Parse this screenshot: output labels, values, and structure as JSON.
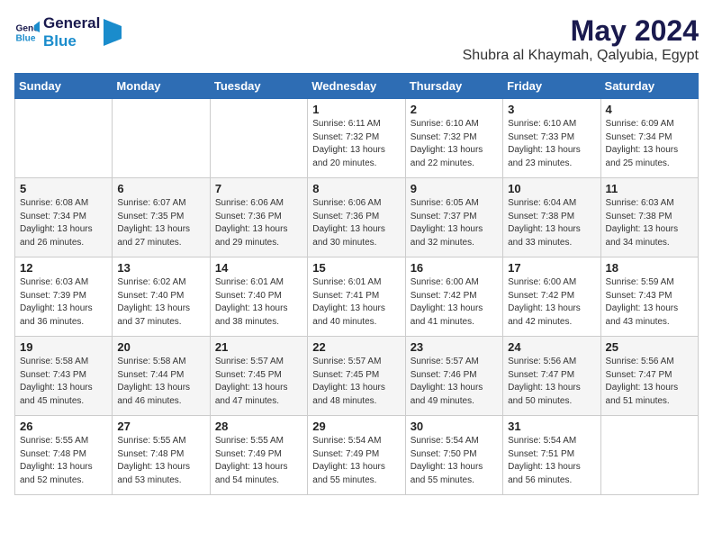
{
  "header": {
    "logo_line1": "General",
    "logo_line2": "Blue",
    "month": "May 2024",
    "location": "Shubra al Khaymah, Qalyubia, Egypt"
  },
  "weekdays": [
    "Sunday",
    "Monday",
    "Tuesday",
    "Wednesday",
    "Thursday",
    "Friday",
    "Saturday"
  ],
  "weeks": [
    [
      {
        "day": "",
        "info": ""
      },
      {
        "day": "",
        "info": ""
      },
      {
        "day": "",
        "info": ""
      },
      {
        "day": "1",
        "info": "Sunrise: 6:11 AM\nSunset: 7:32 PM\nDaylight: 13 hours\nand 20 minutes."
      },
      {
        "day": "2",
        "info": "Sunrise: 6:10 AM\nSunset: 7:32 PM\nDaylight: 13 hours\nand 22 minutes."
      },
      {
        "day": "3",
        "info": "Sunrise: 6:10 AM\nSunset: 7:33 PM\nDaylight: 13 hours\nand 23 minutes."
      },
      {
        "day": "4",
        "info": "Sunrise: 6:09 AM\nSunset: 7:34 PM\nDaylight: 13 hours\nand 25 minutes."
      }
    ],
    [
      {
        "day": "5",
        "info": "Sunrise: 6:08 AM\nSunset: 7:34 PM\nDaylight: 13 hours\nand 26 minutes."
      },
      {
        "day": "6",
        "info": "Sunrise: 6:07 AM\nSunset: 7:35 PM\nDaylight: 13 hours\nand 27 minutes."
      },
      {
        "day": "7",
        "info": "Sunrise: 6:06 AM\nSunset: 7:36 PM\nDaylight: 13 hours\nand 29 minutes."
      },
      {
        "day": "8",
        "info": "Sunrise: 6:06 AM\nSunset: 7:36 PM\nDaylight: 13 hours\nand 30 minutes."
      },
      {
        "day": "9",
        "info": "Sunrise: 6:05 AM\nSunset: 7:37 PM\nDaylight: 13 hours\nand 32 minutes."
      },
      {
        "day": "10",
        "info": "Sunrise: 6:04 AM\nSunset: 7:38 PM\nDaylight: 13 hours\nand 33 minutes."
      },
      {
        "day": "11",
        "info": "Sunrise: 6:03 AM\nSunset: 7:38 PM\nDaylight: 13 hours\nand 34 minutes."
      }
    ],
    [
      {
        "day": "12",
        "info": "Sunrise: 6:03 AM\nSunset: 7:39 PM\nDaylight: 13 hours\nand 36 minutes."
      },
      {
        "day": "13",
        "info": "Sunrise: 6:02 AM\nSunset: 7:40 PM\nDaylight: 13 hours\nand 37 minutes."
      },
      {
        "day": "14",
        "info": "Sunrise: 6:01 AM\nSunset: 7:40 PM\nDaylight: 13 hours\nand 38 minutes."
      },
      {
        "day": "15",
        "info": "Sunrise: 6:01 AM\nSunset: 7:41 PM\nDaylight: 13 hours\nand 40 minutes."
      },
      {
        "day": "16",
        "info": "Sunrise: 6:00 AM\nSunset: 7:42 PM\nDaylight: 13 hours\nand 41 minutes."
      },
      {
        "day": "17",
        "info": "Sunrise: 6:00 AM\nSunset: 7:42 PM\nDaylight: 13 hours\nand 42 minutes."
      },
      {
        "day": "18",
        "info": "Sunrise: 5:59 AM\nSunset: 7:43 PM\nDaylight: 13 hours\nand 43 minutes."
      }
    ],
    [
      {
        "day": "19",
        "info": "Sunrise: 5:58 AM\nSunset: 7:43 PM\nDaylight: 13 hours\nand 45 minutes."
      },
      {
        "day": "20",
        "info": "Sunrise: 5:58 AM\nSunset: 7:44 PM\nDaylight: 13 hours\nand 46 minutes."
      },
      {
        "day": "21",
        "info": "Sunrise: 5:57 AM\nSunset: 7:45 PM\nDaylight: 13 hours\nand 47 minutes."
      },
      {
        "day": "22",
        "info": "Sunrise: 5:57 AM\nSunset: 7:45 PM\nDaylight: 13 hours\nand 48 minutes."
      },
      {
        "day": "23",
        "info": "Sunrise: 5:57 AM\nSunset: 7:46 PM\nDaylight: 13 hours\nand 49 minutes."
      },
      {
        "day": "24",
        "info": "Sunrise: 5:56 AM\nSunset: 7:47 PM\nDaylight: 13 hours\nand 50 minutes."
      },
      {
        "day": "25",
        "info": "Sunrise: 5:56 AM\nSunset: 7:47 PM\nDaylight: 13 hours\nand 51 minutes."
      }
    ],
    [
      {
        "day": "26",
        "info": "Sunrise: 5:55 AM\nSunset: 7:48 PM\nDaylight: 13 hours\nand 52 minutes."
      },
      {
        "day": "27",
        "info": "Sunrise: 5:55 AM\nSunset: 7:48 PM\nDaylight: 13 hours\nand 53 minutes."
      },
      {
        "day": "28",
        "info": "Sunrise: 5:55 AM\nSunset: 7:49 PM\nDaylight: 13 hours\nand 54 minutes."
      },
      {
        "day": "29",
        "info": "Sunrise: 5:54 AM\nSunset: 7:49 PM\nDaylight: 13 hours\nand 55 minutes."
      },
      {
        "day": "30",
        "info": "Sunrise: 5:54 AM\nSunset: 7:50 PM\nDaylight: 13 hours\nand 55 minutes."
      },
      {
        "day": "31",
        "info": "Sunrise: 5:54 AM\nSunset: 7:51 PM\nDaylight: 13 hours\nand 56 minutes."
      },
      {
        "day": "",
        "info": ""
      }
    ]
  ]
}
